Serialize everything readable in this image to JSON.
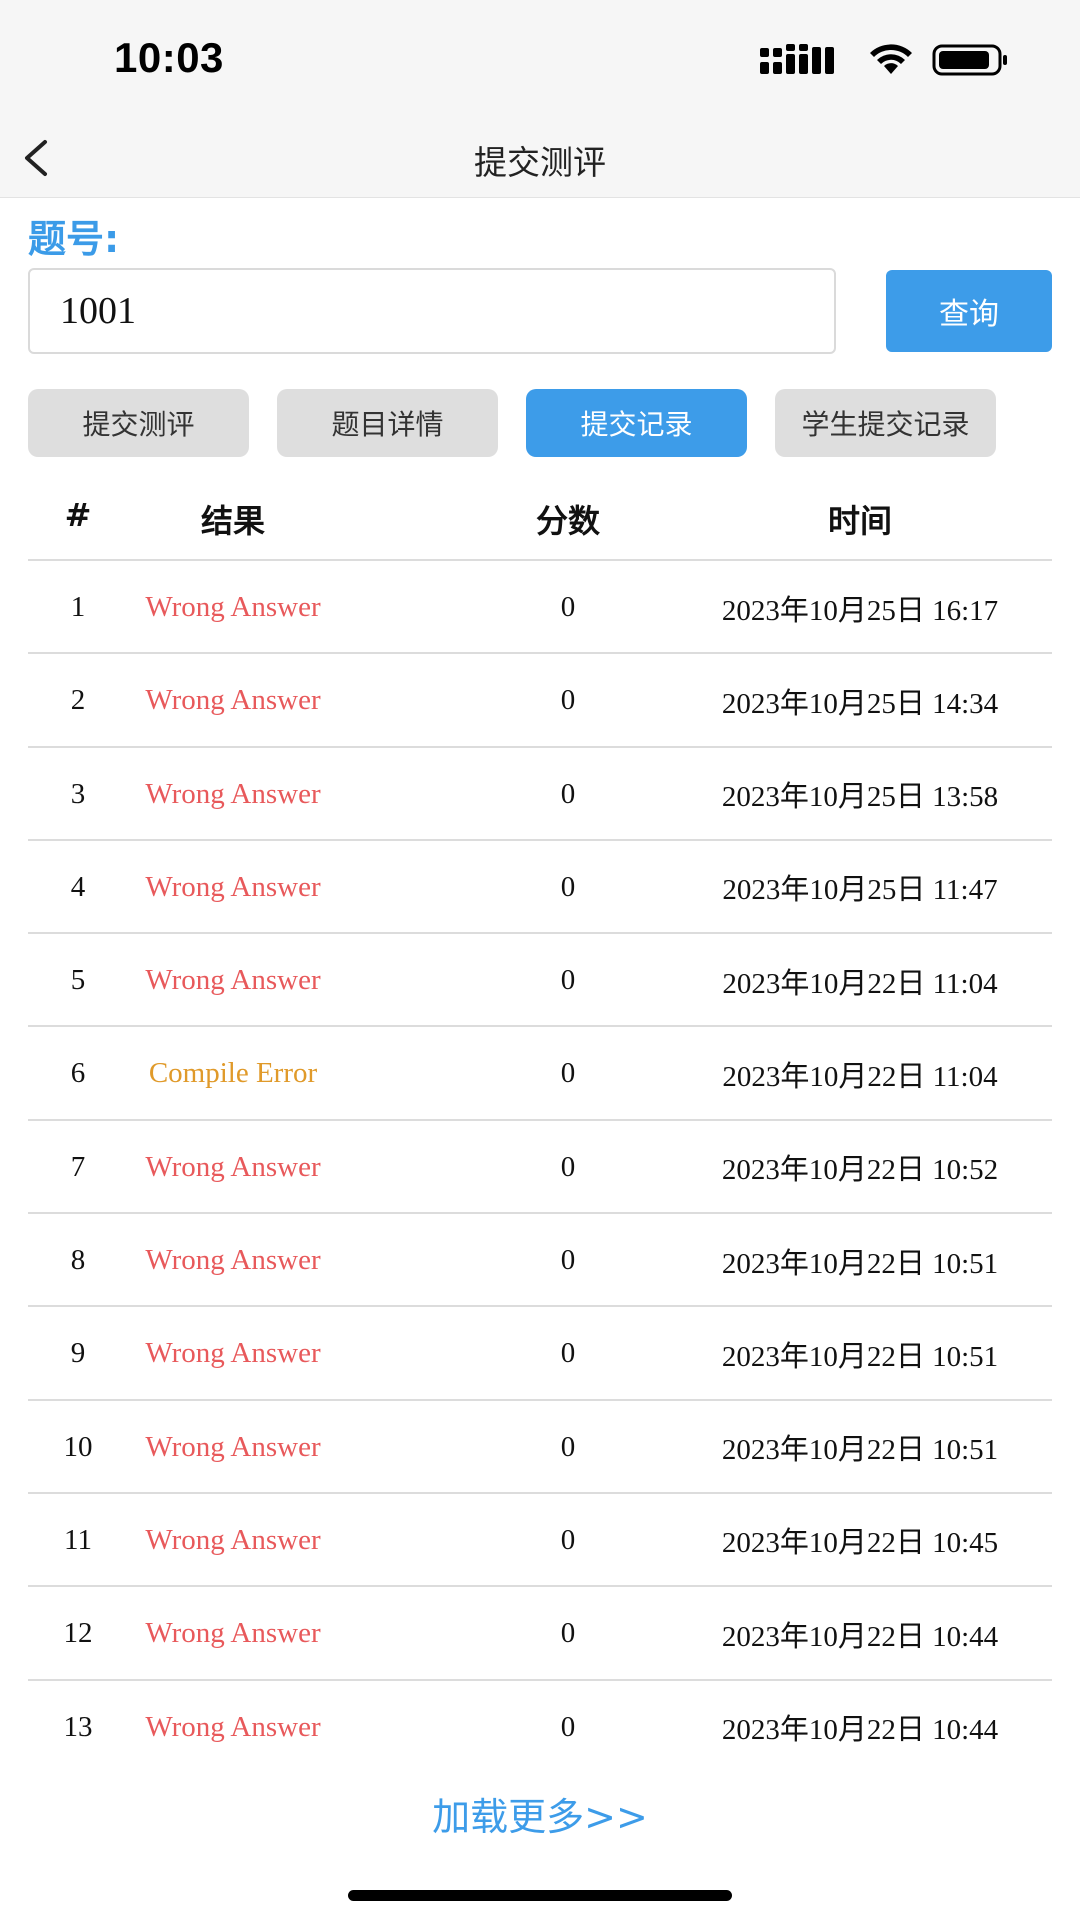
{
  "status_bar": {
    "time": "10:03",
    "icons": [
      "cellular-signal-icon",
      "wifi-icon",
      "battery-icon"
    ]
  },
  "nav": {
    "back_icon": "chevron-left-icon",
    "title": "提交测评"
  },
  "query": {
    "label": "题号:",
    "value": "1001",
    "button_label": "查询"
  },
  "tabs": [
    {
      "label": "提交测评",
      "active": false
    },
    {
      "label": "题目详情",
      "active": false
    },
    {
      "label": "提交记录",
      "active": true
    },
    {
      "label": "学生提交记录",
      "active": false
    }
  ],
  "table": {
    "headers": [
      "#",
      "结果",
      "分数",
      "时间"
    ],
    "rows": [
      {
        "num": "1",
        "result": "Wrong Answer",
        "status": "wa",
        "score": "0",
        "time": "2023年10月25日 16:17"
      },
      {
        "num": "2",
        "result": "Wrong Answer",
        "status": "wa",
        "score": "0",
        "time": "2023年10月25日 14:34"
      },
      {
        "num": "3",
        "result": "Wrong Answer",
        "status": "wa",
        "score": "0",
        "time": "2023年10月25日 13:58"
      },
      {
        "num": "4",
        "result": "Wrong Answer",
        "status": "wa",
        "score": "0",
        "time": "2023年10月25日 11:47"
      },
      {
        "num": "5",
        "result": "Wrong Answer",
        "status": "wa",
        "score": "0",
        "time": "2023年10月22日 11:04"
      },
      {
        "num": "6",
        "result": "Compile Error",
        "status": "ce",
        "score": "0",
        "time": "2023年10月22日 11:04"
      },
      {
        "num": "7",
        "result": "Wrong Answer",
        "status": "wa",
        "score": "0",
        "time": "2023年10月22日 10:52"
      },
      {
        "num": "8",
        "result": "Wrong Answer",
        "status": "wa",
        "score": "0",
        "time": "2023年10月22日 10:51"
      },
      {
        "num": "9",
        "result": "Wrong Answer",
        "status": "wa",
        "score": "0",
        "time": "2023年10月22日 10:51"
      },
      {
        "num": "10",
        "result": "Wrong Answer",
        "status": "wa",
        "score": "0",
        "time": "2023年10月22日 10:51"
      },
      {
        "num": "11",
        "result": "Wrong Answer",
        "status": "wa",
        "score": "0",
        "time": "2023年10月22日 10:45"
      },
      {
        "num": "12",
        "result": "Wrong Answer",
        "status": "wa",
        "score": "0",
        "time": "2023年10月22日 10:44"
      },
      {
        "num": "13",
        "result": "Wrong Answer",
        "status": "wa",
        "score": "0",
        "time": "2023年10月22日 10:44"
      }
    ]
  },
  "load_more": "加载更多>>",
  "colors": {
    "accent": "#3d9ce9",
    "wrong_answer": "#e8595b",
    "compile_error": "#e09a2a",
    "tab_inactive": "#dedede"
  }
}
